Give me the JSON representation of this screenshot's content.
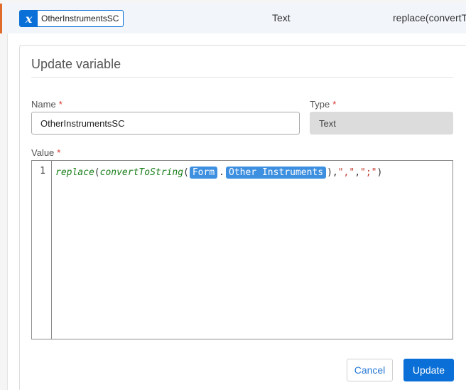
{
  "variable_row": {
    "icon": "x-variable-icon",
    "name": "OtherInstrumentsSC",
    "type": "Text",
    "value_preview": "replace(convertTo"
  },
  "dialog": {
    "title": "Update variable",
    "name_label": "Name",
    "name_value": "OtherInstrumentsSC",
    "type_label": "Type",
    "type_value": "Text",
    "value_label": "Value",
    "required_marker": "*",
    "editor": {
      "line_number": "1",
      "fn_replace": "replace",
      "open_paren": "(",
      "fn_convert": "convertToString",
      "open_paren2": "(",
      "token_form": "Form",
      "dot": ".",
      "token_field": "Other Instruments",
      "close_paren_comma": "),",
      "str_1": "\",\"",
      "comma": ",",
      "str_2": "\";\"",
      "close_paren": ")"
    },
    "cancel_label": "Cancel",
    "update_label": "Update"
  },
  "colors": {
    "accent": "#0a6fd6",
    "row_marker": "#e06b2a",
    "required": "#d9342b",
    "function": "#1a7f1a",
    "string": "#c0392b",
    "token_bg": "#3d8fe0"
  }
}
